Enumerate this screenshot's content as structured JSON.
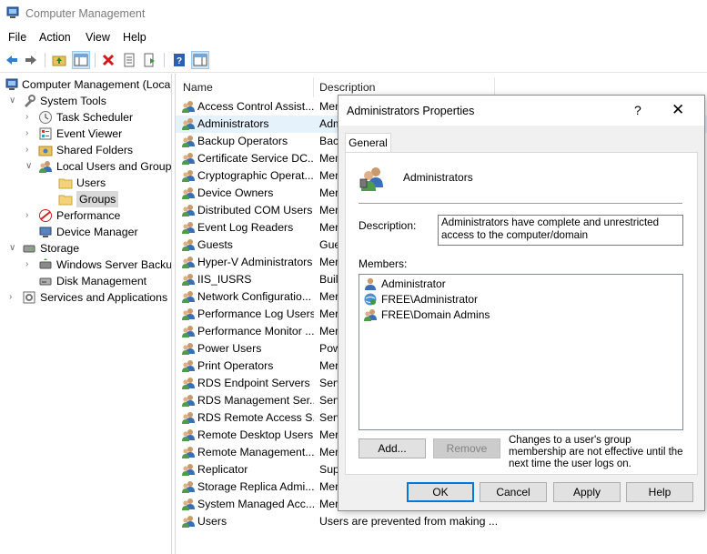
{
  "window": {
    "title": "Computer Management"
  },
  "menu": [
    "File",
    "Action",
    "View",
    "Help"
  ],
  "tree": [
    {
      "label": "Computer Management (Local",
      "level": 0,
      "expander": "",
      "icon": "computer-management-icon",
      "selected": false
    },
    {
      "label": "System Tools",
      "level": 1,
      "expander": "∨",
      "icon": "system-tools-icon",
      "selected": false
    },
    {
      "label": "Task Scheduler",
      "level": 2,
      "expander": "›",
      "icon": "clock-icon",
      "selected": false
    },
    {
      "label": "Event Viewer",
      "level": 2,
      "expander": "›",
      "icon": "event-viewer-icon",
      "selected": false
    },
    {
      "label": "Shared Folders",
      "level": 2,
      "expander": "›",
      "icon": "shared-folders-icon",
      "selected": false
    },
    {
      "label": "Local Users and Groups",
      "level": 2,
      "expander": "∨",
      "icon": "users-groups-icon",
      "selected": false
    },
    {
      "label": "Users",
      "level": 3,
      "expander": "",
      "icon": "folder-icon",
      "selected": false
    },
    {
      "label": "Groups",
      "level": 3,
      "expander": "",
      "icon": "folder-icon",
      "selected": true
    },
    {
      "label": "Performance",
      "level": 2,
      "expander": "›",
      "icon": "performance-icon",
      "selected": false
    },
    {
      "label": "Device Manager",
      "level": 2,
      "expander": "",
      "icon": "device-manager-icon",
      "selected": false
    },
    {
      "label": "Storage",
      "level": 1,
      "expander": "∨",
      "icon": "storage-icon",
      "selected": false
    },
    {
      "label": "Windows Server Backup",
      "level": 2,
      "expander": "›",
      "icon": "backup-icon",
      "selected": false
    },
    {
      "label": "Disk Management",
      "level": 2,
      "expander": "",
      "icon": "disk-icon",
      "selected": false
    },
    {
      "label": "Services and Applications",
      "level": 1,
      "expander": "›",
      "icon": "services-icon",
      "selected": false
    }
  ],
  "list": {
    "columns": [
      "Name",
      "Description"
    ],
    "rows": [
      {
        "name": "Access Control Assist...",
        "desc": "Mem",
        "hl": false
      },
      {
        "name": "Administrators",
        "desc": "Adm",
        "hl": true
      },
      {
        "name": "Backup Operators",
        "desc": "Back",
        "hl": false
      },
      {
        "name": "Certificate Service DC...",
        "desc": "Mem",
        "hl": false
      },
      {
        "name": "Cryptographic Operat...",
        "desc": "Mem",
        "hl": false
      },
      {
        "name": "Device Owners",
        "desc": "Mer",
        "hl": false
      },
      {
        "name": "Distributed COM Users",
        "desc": "Mer",
        "hl": false
      },
      {
        "name": "Event Log Readers",
        "desc": "Mer",
        "hl": false
      },
      {
        "name": "Guests",
        "desc": "Gue",
        "hl": false
      },
      {
        "name": "Hyper-V Administrators",
        "desc": "Mer",
        "hl": false
      },
      {
        "name": "IIS_IUSRS",
        "desc": "Built",
        "hl": false
      },
      {
        "name": "Network Configuratio...",
        "desc": "Mer",
        "hl": false
      },
      {
        "name": "Performance Log Users",
        "desc": "Mer",
        "hl": false
      },
      {
        "name": "Performance Monitor ...",
        "desc": "Mer",
        "hl": false
      },
      {
        "name": "Power Users",
        "desc": "Pow",
        "hl": false
      },
      {
        "name": "Print Operators",
        "desc": "Mer",
        "hl": false
      },
      {
        "name": "RDS Endpoint Servers",
        "desc": "Serv",
        "hl": false
      },
      {
        "name": "RDS Management Ser...",
        "desc": "Serv",
        "hl": false
      },
      {
        "name": "RDS Remote Access S...",
        "desc": "Serv",
        "hl": false
      },
      {
        "name": "Remote Desktop Users",
        "desc": "Mer",
        "hl": false
      },
      {
        "name": "Remote Management...",
        "desc": "Mer",
        "hl": false
      },
      {
        "name": "Replicator",
        "desc": "Sup",
        "hl": false
      },
      {
        "name": "Storage Replica Admi...",
        "desc": "Mer",
        "hl": false
      },
      {
        "name": "System Managed Acc...",
        "desc": "Mer",
        "hl": false
      },
      {
        "name": "Users",
        "desc": "Users are prevented from making ...",
        "hl": false
      }
    ]
  },
  "dialog": {
    "title": "Administrators Properties",
    "help": "?",
    "close": "✕",
    "tab": "General",
    "group_name": "Administrators",
    "description_label": "Description:",
    "description": "Administrators have complete and unrestricted access to the computer/domain",
    "members_label": "Members:",
    "members": [
      {
        "name": "Administrator",
        "icon": "user-icon"
      },
      {
        "name": "FREE\\Administrator",
        "icon": "domain-user-icon"
      },
      {
        "name": "FREE\\Domain Admins",
        "icon": "domain-group-icon"
      }
    ],
    "add": "Add...",
    "remove": "Remove",
    "note": "Changes to a user's group membership are not effective until the next time the user logs on.",
    "ok": "OK",
    "cancel": "Cancel",
    "apply": "Apply",
    "help_btn": "Help"
  },
  "colors": {
    "selected_row": "#e5f1fb",
    "tree_selected": "#d9d9d9",
    "accent": "#0078d7"
  }
}
